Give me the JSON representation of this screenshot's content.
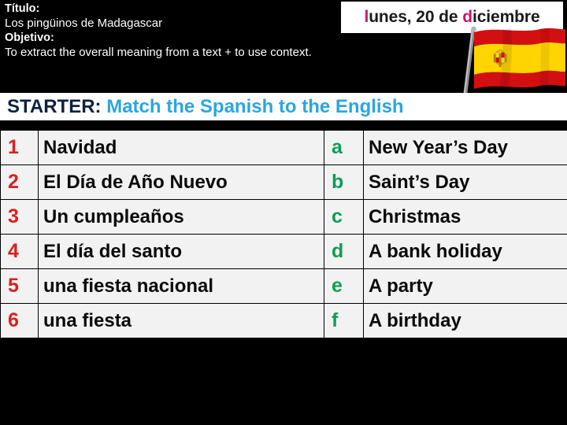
{
  "header": {
    "title_label": "Título:",
    "title_value": "Los pingüinos de Madagascar",
    "objective_label": "Objetivo:",
    "objective_value": "To extract the overall meaning from a text + to use context."
  },
  "date_badge": {
    "full": "lunes, 20 de diciembre",
    "part1_accent": "l",
    "part1_rest": "unes, 20 de ",
    "part2_accent": "d",
    "part2_rest": "iciembre",
    "accent_color": "#cc1569"
  },
  "flag": {
    "name": "spain-flag",
    "colors": {
      "red": "#d40f12",
      "yellow": "#ffd400",
      "pole": "#9b9b9b"
    }
  },
  "starter": {
    "label": "STARTER:",
    "instruction": "Match the Spanish to the English",
    "label_color": "#0d2240",
    "instruction_color": "#2ba6e0"
  },
  "match_activity": {
    "number_color": "#d9201f",
    "letter_color": "#0e9e55",
    "rows": [
      {
        "num": "1",
        "spanish": "Navidad",
        "letter": "a",
        "english": "New Year’s Day"
      },
      {
        "num": "2",
        "spanish": "El Día de Año Nuevo",
        "letter": "b",
        "english": "Saint’s Day"
      },
      {
        "num": "3",
        "spanish": "Un cumpleaños",
        "letter": "c",
        "english": "Christmas"
      },
      {
        "num": "4",
        "spanish": "El día del santo",
        "letter": "d",
        "english": "A bank holiday"
      },
      {
        "num": "5",
        "spanish": "una fiesta nacional",
        "letter": "e",
        "english": "A party"
      },
      {
        "num": "6",
        "spanish": "una fiesta",
        "letter": "f",
        "english": "A birthday"
      }
    ]
  }
}
